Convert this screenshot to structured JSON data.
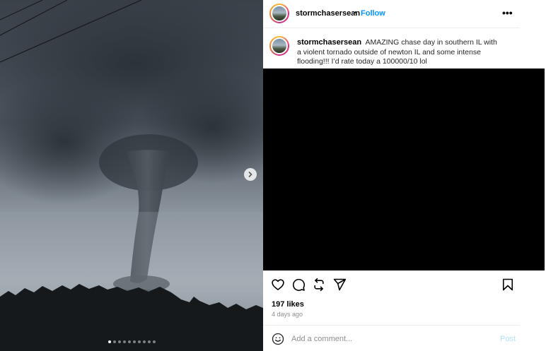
{
  "post": {
    "username": "stormchasersean",
    "separator": "•",
    "follow_label": "Follow",
    "more_label": "•••",
    "caption_username": "stormchasersean",
    "caption_text": "AMAZING chase day in southern IL with a violent tornado outside of newton IL and some intense flooding!!! I’d rate today a 100000/10 lol",
    "likes": "197 likes",
    "time_ago": "4 days ago"
  },
  "carousel": {
    "slide_count": 10,
    "active_index": 0
  },
  "comment": {
    "placeholder": "Add a comment...",
    "post_label": "Post"
  },
  "icons": {
    "like": "heart-icon",
    "comment": "comment-bubble-icon",
    "repost": "repost-icon",
    "share": "send-icon",
    "save": "bookmark-icon",
    "emoji": "smiley-icon",
    "next": "chevron-right-icon"
  },
  "colors": {
    "link_blue": "#0095f6",
    "post_disabled": "#b2dffc",
    "muted": "#8e8e8e"
  }
}
